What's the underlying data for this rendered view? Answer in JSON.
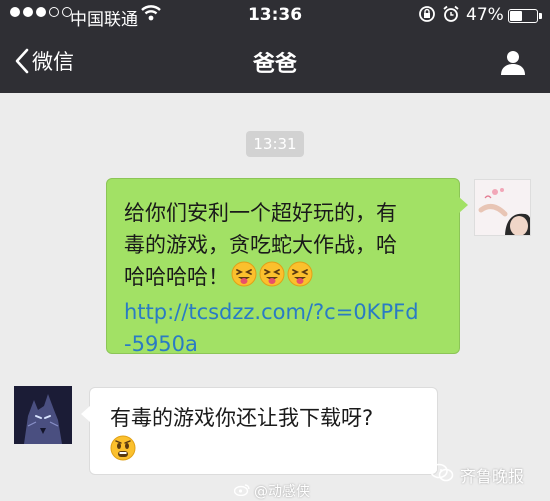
{
  "status_bar": {
    "carrier": "中国联通",
    "time": "13:36",
    "battery_pct": "47%",
    "battery_level": 0.47
  },
  "nav": {
    "back_label": "微信",
    "title": "爸爸"
  },
  "chat": {
    "timestamp": "13:31",
    "outgoing": {
      "line1": "给你们安利一个超好玩的，有",
      "line2": "毒的游戏，贪吃蛇大作战，哈",
      "line3": "哈哈哈哈！",
      "link_line1": "http://tcsdzz.com/?c=0KPFd",
      "link_line2": "-5950a",
      "emojis": [
        "grinning-tongue-emoji",
        "grinning-tongue-emoji",
        "grinning-tongue-emoji"
      ]
    },
    "incoming": {
      "text": "有毒的游戏你还让我下载呀?",
      "emoji": "fearful-emoji"
    }
  },
  "watermark": "齐鲁晚报",
  "credit": "@动感侠",
  "colors": {
    "topbar": "#2f2f34",
    "chat_bg": "#ececec",
    "bubble_out": "#a2e165",
    "bubble_in": "#ffffff",
    "link": "#2a7bc4"
  }
}
